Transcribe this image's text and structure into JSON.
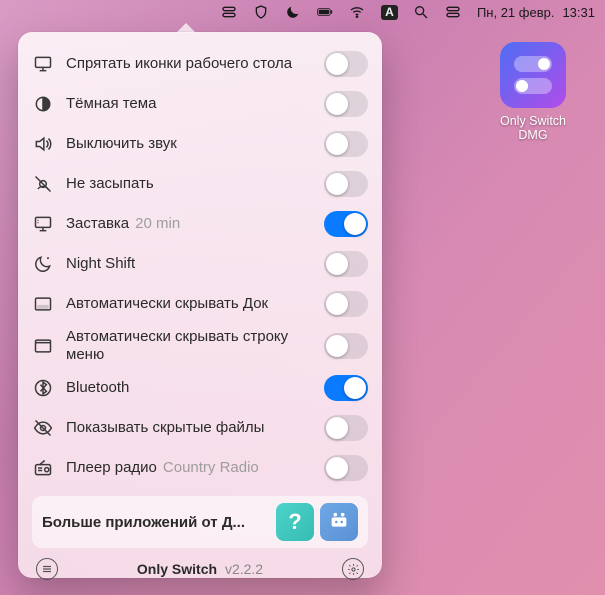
{
  "menubar": {
    "date": "Пн, 21 февр.",
    "time": "13:31"
  },
  "desktop": {
    "icon_label": "Only Switch DMG"
  },
  "panel": {
    "rows": [
      {
        "icon": "display",
        "label": "Спрятать иконки рабочего стола",
        "sub": "",
        "on": false
      },
      {
        "icon": "half-circle",
        "label": "Тёмная тема",
        "sub": "",
        "on": false
      },
      {
        "icon": "speaker",
        "label": "Выключить звук",
        "sub": "",
        "on": false
      },
      {
        "icon": "no-sleep",
        "label": "Не засыпать",
        "sub": "",
        "on": false
      },
      {
        "icon": "screensaver",
        "label": "Заставка",
        "sub": "20 min",
        "on": true
      },
      {
        "icon": "night-shift",
        "label": "Night Shift",
        "sub": "",
        "on": false
      },
      {
        "icon": "dock",
        "label": "Автоматически скрывать Док",
        "sub": "",
        "on": false
      },
      {
        "icon": "menu-hide",
        "label": "Автоматически скрывать строку меню",
        "sub": "",
        "on": false
      },
      {
        "icon": "bluetooth",
        "label": "Bluetooth",
        "sub": "",
        "on": true
      },
      {
        "icon": "eye-slash",
        "label": "Показывать скрытые файлы",
        "sub": "",
        "on": false
      },
      {
        "icon": "radio",
        "label": "Плеер радио",
        "sub": "Country Radio",
        "on": false
      }
    ],
    "promo": {
      "text": "Больше приложений от Д..."
    },
    "footer": {
      "title": "Only Switch",
      "version": "v2.2.2"
    }
  }
}
